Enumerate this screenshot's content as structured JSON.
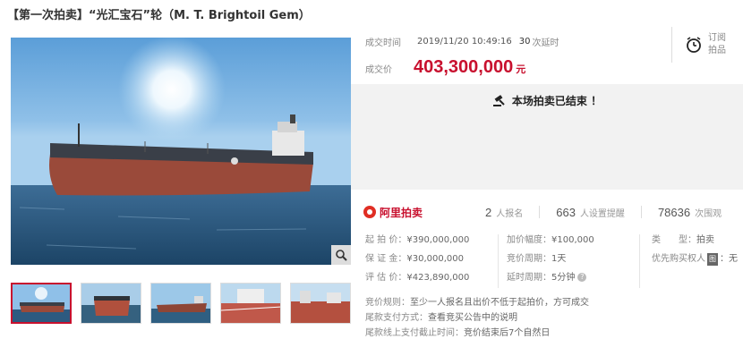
{
  "title": "【第一次拍卖】“光汇宝石”轮（M. T. Brightoil Gem）",
  "deal": {
    "time_label": "成交时间",
    "time_value": "2019/11/20 10:49:16",
    "delay_count": "30",
    "delay_suffix": "次延时",
    "price_label": "成交价",
    "price": "403,300,000",
    "price_unit": "元"
  },
  "follow": {
    "line1": "订阅",
    "line2": "拍品",
    "icon": "alarm-clock-icon"
  },
  "status": {
    "text": "本场拍卖已结束 ！",
    "icon": "gavel-icon"
  },
  "platform": {
    "name": "阿里拍卖"
  },
  "stats": [
    {
      "num": "2",
      "label": "人报名"
    },
    {
      "num": "663",
      "label": "人设置提醒"
    },
    {
      "num": "78636",
      "label": "次围观"
    }
  ],
  "details": {
    "col1": [
      {
        "label": "起 拍 价：",
        "value": "¥390,000,000"
      },
      {
        "label": "保 证 金：",
        "value": "¥30,000,000"
      },
      {
        "label": "评 估 价：",
        "value": "¥423,890,000"
      }
    ],
    "col2": [
      {
        "label": "加价幅度：",
        "value": "¥100,000"
      },
      {
        "label": "竞价周期：",
        "value": "1天"
      },
      {
        "label": "延时周期：",
        "value": "5分钟"
      }
    ],
    "col3": [
      {
        "label": "类　　型：",
        "value": "拍卖"
      },
      {
        "label": "优先购买权人",
        "badge": "图",
        "value": "：无"
      }
    ]
  },
  "rules": [
    {
      "label": "竞价规则：",
      "value": "至少一人报名且出价不低于起拍价，方可成交"
    },
    {
      "label": "尾款支付方式：",
      "value": "查看竞买公告中的说明"
    },
    {
      "label": "尾款线上支付截止时间：",
      "value": "竞价结束后7个自然日"
    }
  ],
  "colors": {
    "accent": "#c8102e",
    "status_bg": "#f2f2f2"
  }
}
